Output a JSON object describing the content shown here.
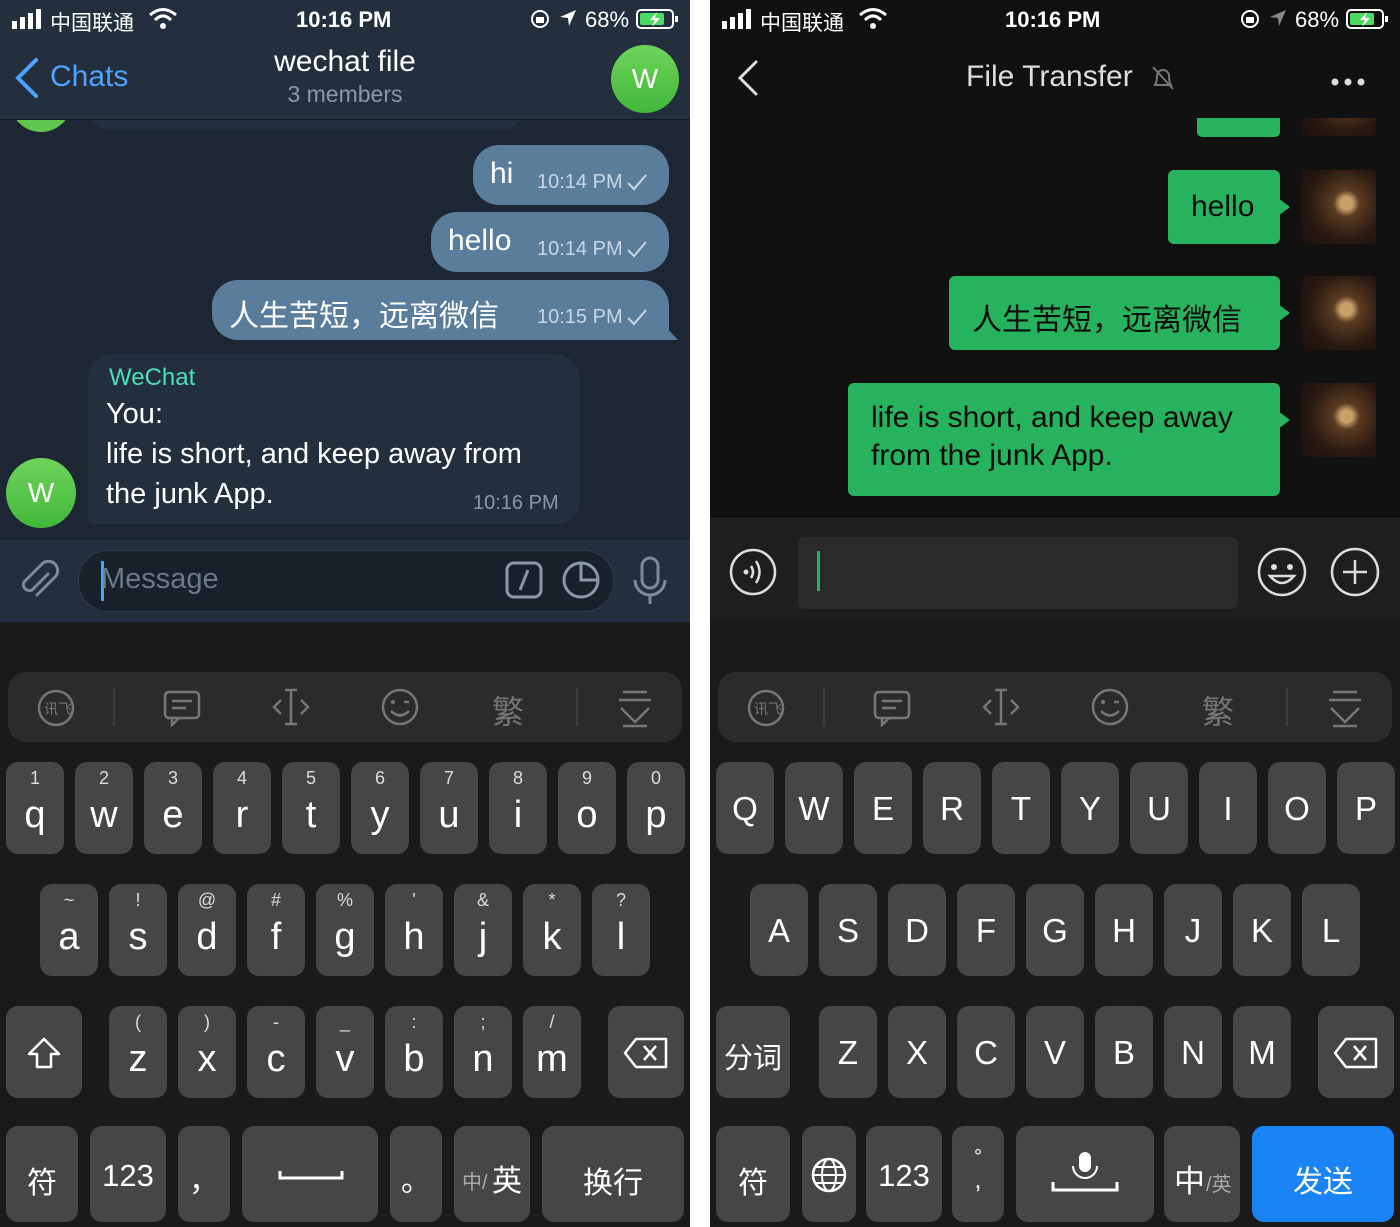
{
  "left": {
    "status": {
      "carrier": "中国联通",
      "time": "10:16 PM",
      "battery": "68%"
    },
    "header": {
      "back_label": "Chats",
      "title": "wechat file",
      "subtitle": "3 members",
      "avatar_letter": "W"
    },
    "messages": [
      {
        "text": "hi",
        "time": "10:14 PM"
      },
      {
        "text": "hello",
        "time": "10:14 PM"
      },
      {
        "text": "人生苦短，远离微信",
        "time": "10:15 PM"
      }
    ],
    "incoming": {
      "sender": "WeChat",
      "line1": "You:",
      "line2": "life is short, and keep away from",
      "line3": "the junk App.",
      "time": "10:16 PM",
      "avatar_letter": "W"
    },
    "composer": {
      "placeholder": "Message"
    },
    "keyboard": {
      "row1": [
        {
          "hint": "1",
          "key": "q"
        },
        {
          "hint": "2",
          "key": "w"
        },
        {
          "hint": "3",
          "key": "e"
        },
        {
          "hint": "4",
          "key": "r"
        },
        {
          "hint": "5",
          "key": "t"
        },
        {
          "hint": "6",
          "key": "y"
        },
        {
          "hint": "7",
          "key": "u"
        },
        {
          "hint": "8",
          "key": "i"
        },
        {
          "hint": "9",
          "key": "o"
        },
        {
          "hint": "0",
          "key": "p"
        }
      ],
      "row2": [
        {
          "hint": "~",
          "key": "a"
        },
        {
          "hint": "!",
          "key": "s"
        },
        {
          "hint": "@",
          "key": "d"
        },
        {
          "hint": "#",
          "key": "f"
        },
        {
          "hint": "%",
          "key": "g"
        },
        {
          "hint": "'",
          "key": "h"
        },
        {
          "hint": "&",
          "key": "j"
        },
        {
          "hint": "*",
          "key": "k"
        },
        {
          "hint": "?",
          "key": "l"
        }
      ],
      "row3": [
        {
          "hint": "(",
          "key": "z"
        },
        {
          "hint": ")",
          "key": "x"
        },
        {
          "hint": "-",
          "key": "c"
        },
        {
          "hint": "_",
          "key": "v"
        },
        {
          "hint": ":",
          "key": "b"
        },
        {
          "hint": ";",
          "key": "n"
        },
        {
          "hint": "/",
          "key": "m"
        }
      ],
      "symbols": "符",
      "numbers": "123",
      "comma": "，",
      "period": "。",
      "lang_a": "中/",
      "lang_b": "英",
      "enter": "换行",
      "toolbar_trad": "繁"
    }
  },
  "right": {
    "status": {
      "carrier": "中国联通",
      "time": "10:16 PM",
      "battery": "68%"
    },
    "header": {
      "title": "File Transfer"
    },
    "messages": [
      {
        "text": "hello"
      },
      {
        "text": "人生苦短，远离微信"
      },
      {
        "line1": "life is short, and keep away",
        "line2": "from the junk App."
      }
    ],
    "keyboard": {
      "row1": [
        "Q",
        "W",
        "E",
        "R",
        "T",
        "Y",
        "U",
        "I",
        "O",
        "P"
      ],
      "row2": [
        "A",
        "S",
        "D",
        "F",
        "G",
        "H",
        "J",
        "K",
        "L"
      ],
      "row3": [
        "Z",
        "X",
        "C",
        "V",
        "B",
        "N",
        "M"
      ],
      "fenci": "分词",
      "symbols": "符",
      "numbers": "123",
      "punct_top": "°",
      "punct_bottom": ",",
      "lang_a": "中",
      "lang_b": "/英",
      "send": "发送",
      "toolbar_trad": "繁"
    }
  },
  "colors": {
    "telegram_accent": "#4fa3ff",
    "wechat_green": "#27b35d",
    "send_blue": "#1a84f5",
    "sender_teal": "#4ddfb9"
  }
}
